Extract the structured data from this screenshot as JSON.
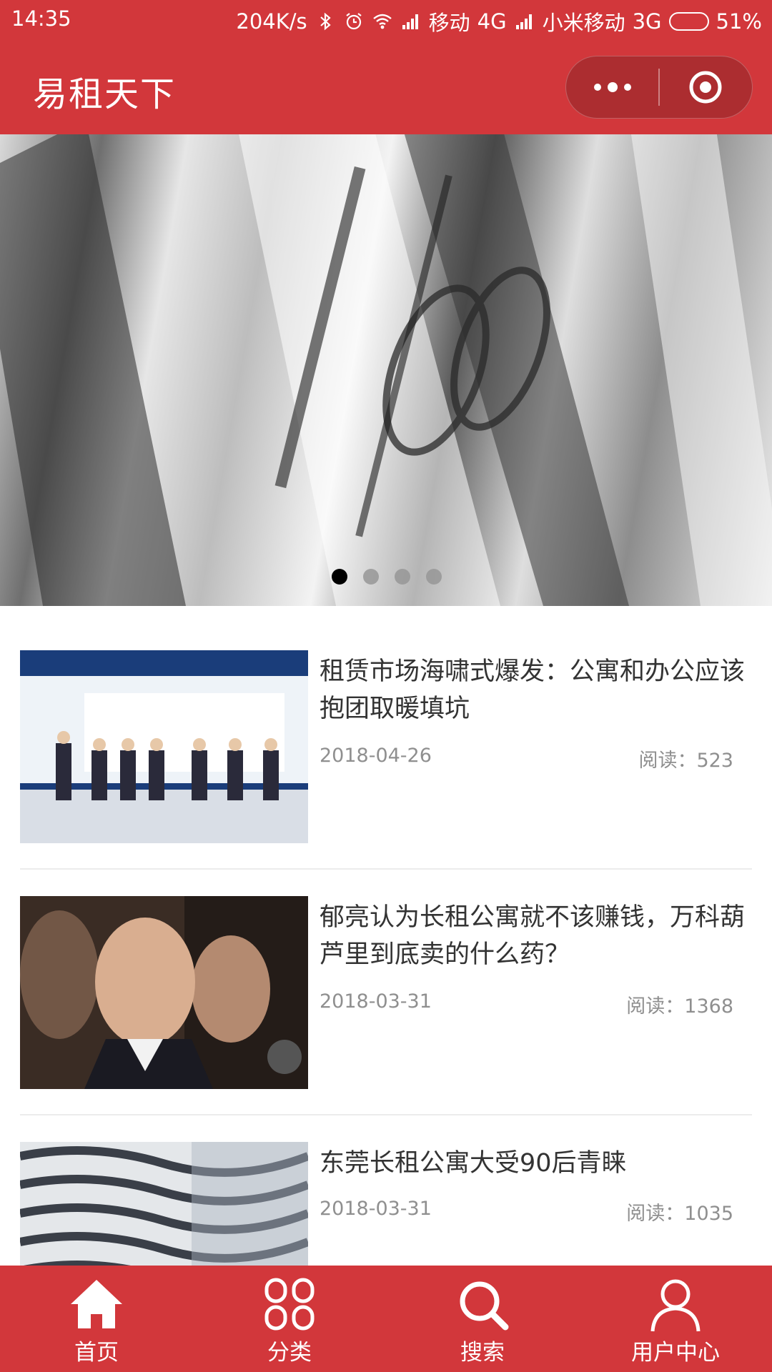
{
  "status_bar": {
    "time": "14:35",
    "speed": "204K/s",
    "carrier1": "移动",
    "network1": "4G",
    "carrier2": "小米移动",
    "network2": "3G",
    "battery": "51%",
    "battery_level": 0.51
  },
  "nav": {
    "title": "易租天下"
  },
  "banner": {
    "slide_count": 4,
    "active_index": 0
  },
  "articles": [
    {
      "title": "租赁市场海啸式爆发：公寓和办公应该抱团取暖填坑",
      "date": "2018-04-26",
      "reads": "阅读：523"
    },
    {
      "title": "郁亮认为长租公寓就不该赚钱，万科葫芦里到底卖的什么药？",
      "date": "2018-03-31",
      "reads": "阅读：1368"
    },
    {
      "title": "东莞长租公寓大受90后青睐",
      "date": "2018-03-31",
      "reads": "阅读：1035"
    }
  ],
  "tabs": [
    {
      "label": "首页",
      "icon": "home-icon"
    },
    {
      "label": "分类",
      "icon": "category-icon"
    },
    {
      "label": "搜索",
      "icon": "search-icon"
    },
    {
      "label": "用户中心",
      "icon": "user-icon"
    }
  ],
  "colors": {
    "brand": "#d2373b",
    "text": "#333333",
    "meta": "#8f8f8f"
  }
}
